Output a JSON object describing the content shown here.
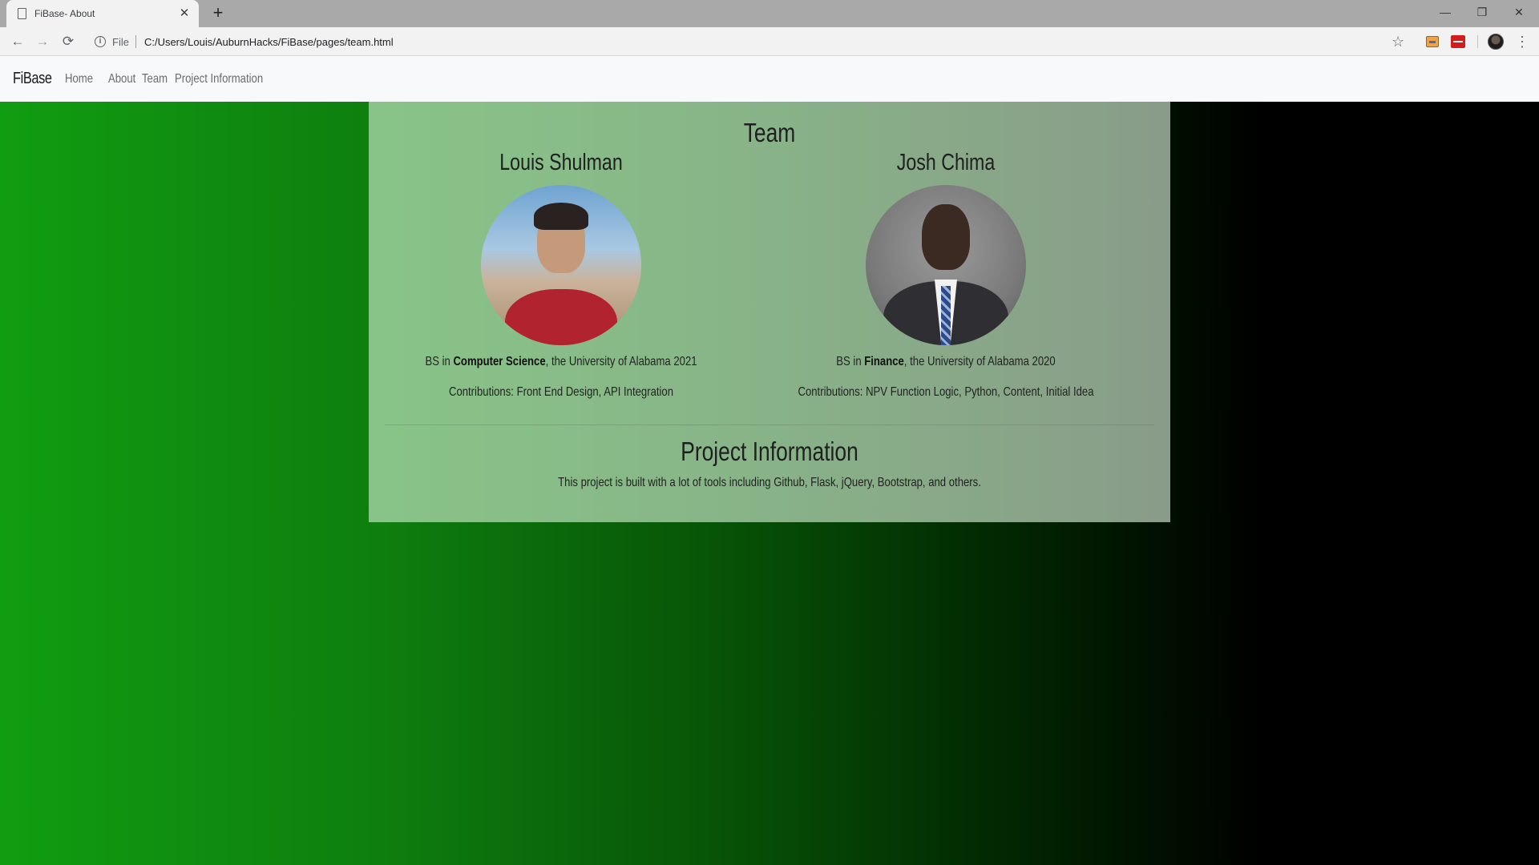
{
  "browser": {
    "tab_title": "FiBase- About",
    "new_tab_symbol": "+",
    "url_scheme": "File",
    "url": "C:/Users/Louis/AuburnHacks/FiBase/pages/team.html"
  },
  "navbar": {
    "brand": "FiBase",
    "links": [
      "Home",
      "About",
      "Team",
      "Project Information"
    ]
  },
  "team": {
    "title": "Team",
    "members": [
      {
        "name": "Louis Shulman",
        "degree_prefix": "BS in ",
        "degree_field": "Computer Science",
        "degree_suffix": ", the University of Alabama 2021",
        "contributions": "Contributions: Front End Design, API Integration"
      },
      {
        "name": "Josh Chima",
        "degree_prefix": "BS in ",
        "degree_field": "Finance",
        "degree_suffix": ", the University of Alabama 2020",
        "contributions": "Contributions: NPV Function Logic, Python, Content, Initial Idea"
      }
    ]
  },
  "project": {
    "title": "Project Information",
    "text": "This project is built with a lot of tools including Github, Flask, jQuery, Bootstrap, and others."
  },
  "colors": {
    "background_gradient_start": "#119d11",
    "background_gradient_end": "#000000",
    "navbar_bg": "#f8f9fa"
  }
}
